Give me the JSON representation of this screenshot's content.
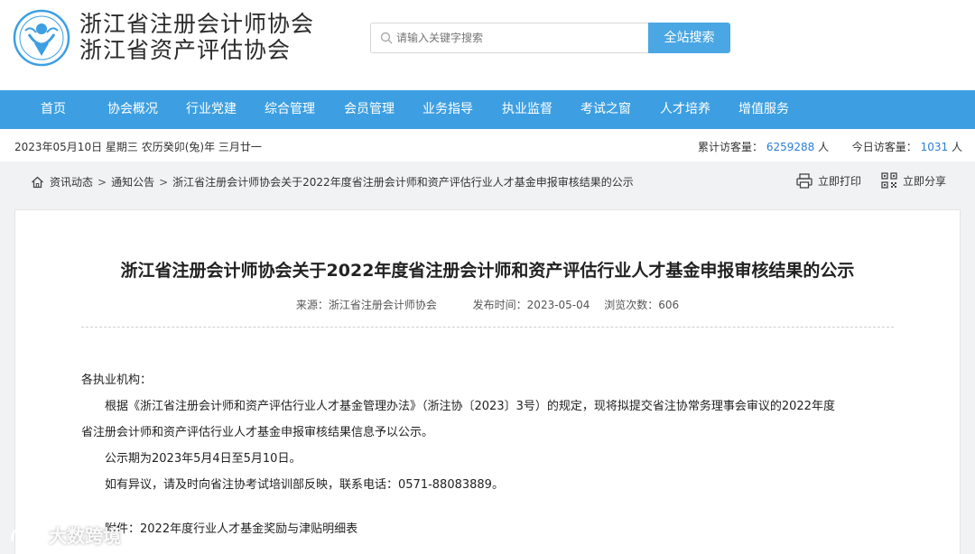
{
  "header": {
    "org_name_1": "浙江省注册会计师协会",
    "org_name_2": "浙江省资产评估协会",
    "search_placeholder": "请输入关键字搜索",
    "search_button": "全站搜索"
  },
  "nav": {
    "items": [
      "首页",
      "协会概况",
      "行业党建",
      "综合管理",
      "会员管理",
      "业务指导",
      "执业监督",
      "考试之窗",
      "人才培养",
      "增值服务"
    ]
  },
  "infobar": {
    "date": "2023年05月10日 星期三 农历癸卯(兔)年 三月廿一",
    "total_visits_label": "累计访客量：",
    "total_visits": "6259288",
    "total_unit": "人",
    "today_visits_label": "今日访客量：",
    "today_visits": "1031",
    "today_unit": "人"
  },
  "breadcrumb": {
    "items": [
      "资讯动态",
      "通知公告",
      "浙江省注册会计师协会关于2022年度省注册会计师和资产评估行业人才基金申报审核结果的公示"
    ],
    "sep": ">"
  },
  "actions": {
    "print": "立即打印",
    "share": "立即分享"
  },
  "article": {
    "title": "浙江省注册会计师协会关于2022年度省注册会计师和资产评估行业人才基金申报审核结果的公示",
    "source": "来源：浙江省注册会计师协会",
    "published": "发布时间：2023-05-04",
    "views": "浏览次数：606",
    "salutation": "各执业机构：",
    "p1_line1": "根据《浙江省注册会计师和资产评估行业人才基金管理办法》（浙注协〔2023〕3号）的规定，现将拟提交省注协常务理事会审议的2022年度",
    "p1_line2": "省注册会计师和资产评估行业人才基金申报审核结果信息予以公示。",
    "p2": "公示期为2023年5月4日至5月10日。",
    "p3": "如有异议，请及时向省注协考试培训部反映，联系电话：0571-88083889。",
    "attachment": "附件：2022年度行业人才基金奖励与津贴明细表"
  },
  "watermark": "大数跨境",
  "colors": {
    "nav": "#3d9fe2",
    "search_button": "#4aa7e4",
    "visit_number": "#2a7ed6"
  }
}
